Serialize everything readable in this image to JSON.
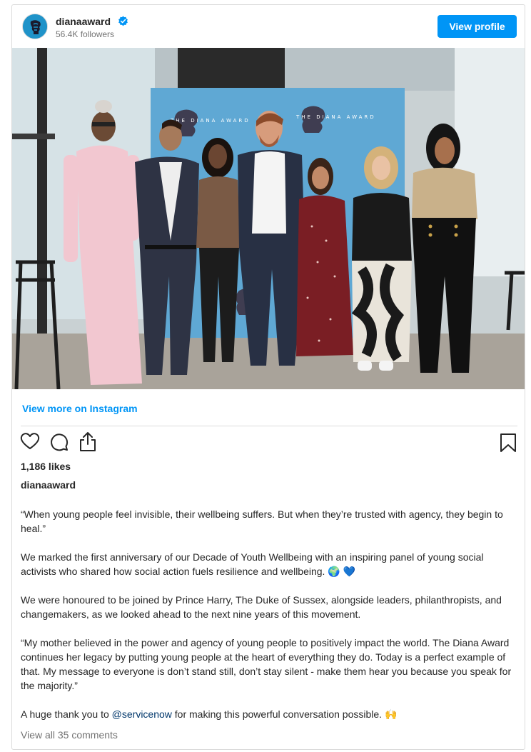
{
  "header": {
    "username": "dianaaward",
    "followers": "56.4K followers",
    "view_profile": "View profile",
    "verified_icon": "verified-badge-icon",
    "accent_color": "#0095f6"
  },
  "post": {
    "view_more": "View more on Instagram",
    "likes": "1,186 likes",
    "caption_user": "dianaaward",
    "caption": {
      "quote": "“When young people feel invisible, their wellbeing suffers. But when they’re trusted with agency, they begin to heal.”",
      "p2": "We marked the first anniversary of our Decade of Youth Wellbeing with an inspiring panel of young social activists who shared how social action fuels resilience and wellbeing.",
      "p2_emoji": "🌍 💙",
      "p3": "We were honoured to be joined by Prince Harry, The Duke of Sussex, alongside leaders, philanthropists, and changemakers, as we looked ahead to the next nine years of this movement.",
      "p4": "“My mother believed in the power and agency of young people to positively impact the world. The Diana Award continues her legacy by putting young people at the heart of everything they do. Today is a perfect example of that. My message to everyone is don’t stand still, don’t stay silent - make them hear you because you speak for the majority.”",
      "p5_before": "A huge thank you to ",
      "p5_mention": "@servicenow",
      "p5_after": " for making this powerful conversation possible.",
      "p5_emoji": "🙌"
    },
    "comments": "View all 35 comments",
    "banner_text": "THE DIANA AWARD"
  },
  "icons": [
    "heart-icon",
    "comment-icon",
    "share-icon",
    "bookmark-icon"
  ]
}
